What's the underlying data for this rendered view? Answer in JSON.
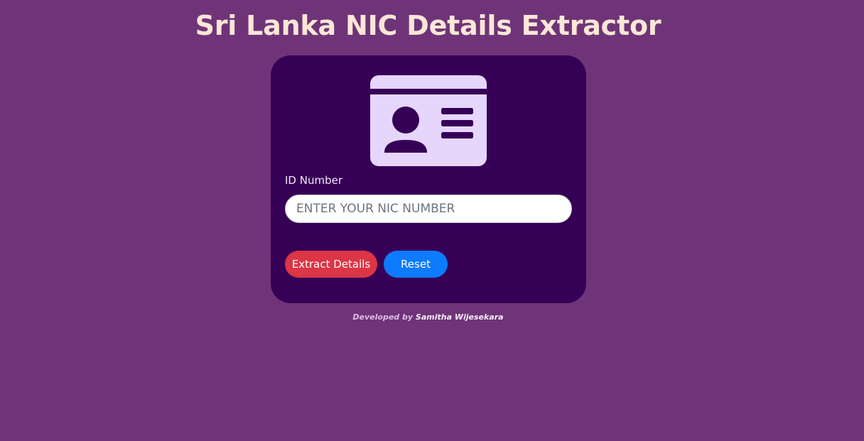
{
  "page": {
    "title": "Sri Lanka NIC Details Extractor"
  },
  "form": {
    "icon": "id-card-icon",
    "id_label": "ID Number",
    "nic_input_placeholder": "ENTER YOUR NIC NUMBER",
    "nic_input_value": "",
    "extract_button_label": "Extract Details",
    "reset_button_label": "Reset"
  },
  "footer": {
    "prefix": "Developed by",
    "author": "Samitha Wijesekara"
  },
  "colors": {
    "page_background": "#6f3478",
    "card_background": "#360057",
    "title_text": "#fde7d6",
    "id_card_icon": "#e6d6fb",
    "extract_button": "#dc3545",
    "reset_button": "#0d7bff"
  }
}
